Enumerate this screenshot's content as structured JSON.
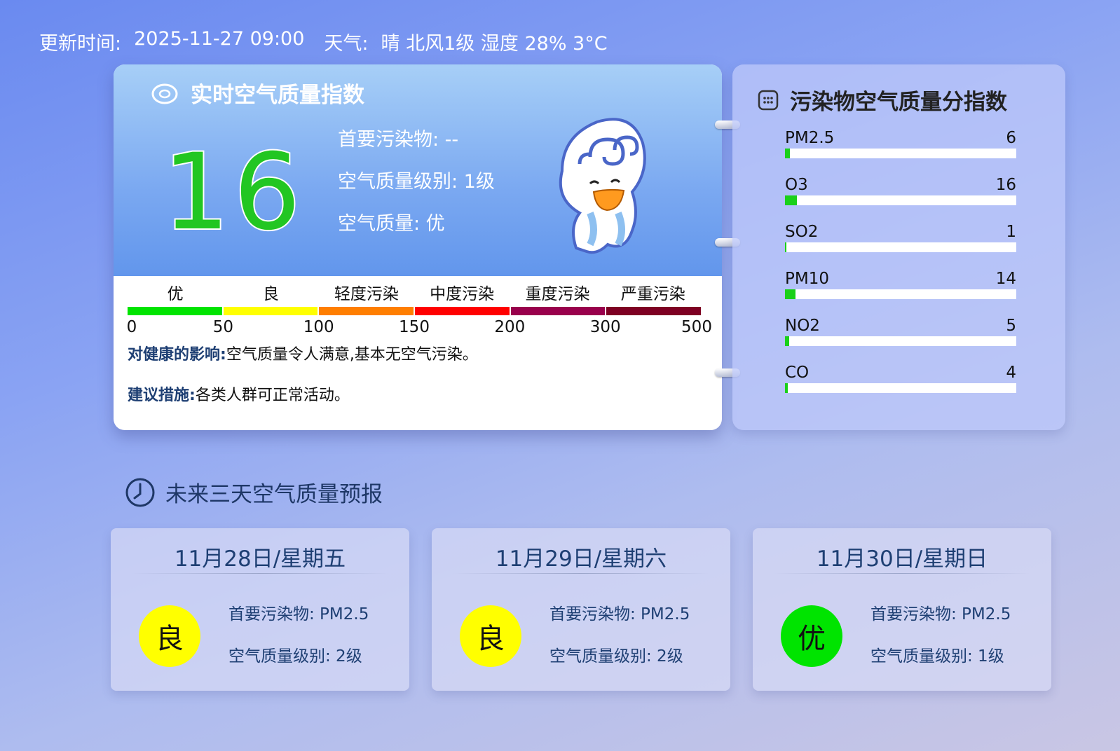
{
  "header": {
    "update_label": "更新时间:",
    "update_time": "2025-11-27 09:00",
    "weather_label": "天气:",
    "weather_value": "晴 北风1级 湿度 28% 3°C"
  },
  "realtime": {
    "title": "实时空气质量指数",
    "aqi": "16",
    "primary_pollutant": "首要污染物: --",
    "level": "空气质量级别: 1级",
    "quality": "空气质量: 优",
    "scale_labels": [
      "优",
      "良",
      "轻度污染",
      "中度污染",
      "重度污染",
      "严重污染"
    ],
    "scale_colors": [
      "#00e400",
      "#ffff00",
      "#ff7e00",
      "#ff0000",
      "#99004c",
      "#7e0023"
    ],
    "scale_ticks": [
      "0",
      "50",
      "100",
      "150",
      "200",
      "300",
      "500"
    ],
    "health_label": "对健康的影响:",
    "health_text": "空气质量令人满意,基本无空气污染。",
    "advice_label": "建议措施:",
    "advice_text": "各类人群可正常活动。"
  },
  "pollutants": {
    "title": "污染物空气质量分指数",
    "items": [
      {
        "name": "PM2.5",
        "value": "6",
        "fraction": 0.02
      },
      {
        "name": "O3",
        "value": "16",
        "fraction": 0.05
      },
      {
        "name": "SO2",
        "value": "1",
        "fraction": 0.004
      },
      {
        "name": "PM10",
        "value": "14",
        "fraction": 0.045
      },
      {
        "name": "NO2",
        "value": "5",
        "fraction": 0.018
      },
      {
        "name": "CO",
        "value": "4",
        "fraction": 0.013
      }
    ]
  },
  "forecast": {
    "title": "未来三天空气质量预报",
    "days": [
      {
        "date": "11月28日/星期五",
        "badge": "良",
        "badge_color": "#ffff00",
        "primary": "首要污染物: PM2.5",
        "level": "空气质量级别: 2级"
      },
      {
        "date": "11月29日/星期六",
        "badge": "良",
        "badge_color": "#ffff00",
        "primary": "首要污染物: PM2.5",
        "level": "空气质量级别: 2级"
      },
      {
        "date": "11月30日/星期日",
        "badge": "优",
        "badge_color": "#00e400",
        "primary": "首要污染物: PM2.5",
        "level": "空气质量级别: 1级"
      }
    ]
  },
  "icons": {
    "title_icon": "cloud-icon",
    "pollutant_icon": "grid-icon",
    "forecast_icon": "clock-icon",
    "mascot": "mascot-illustration"
  }
}
